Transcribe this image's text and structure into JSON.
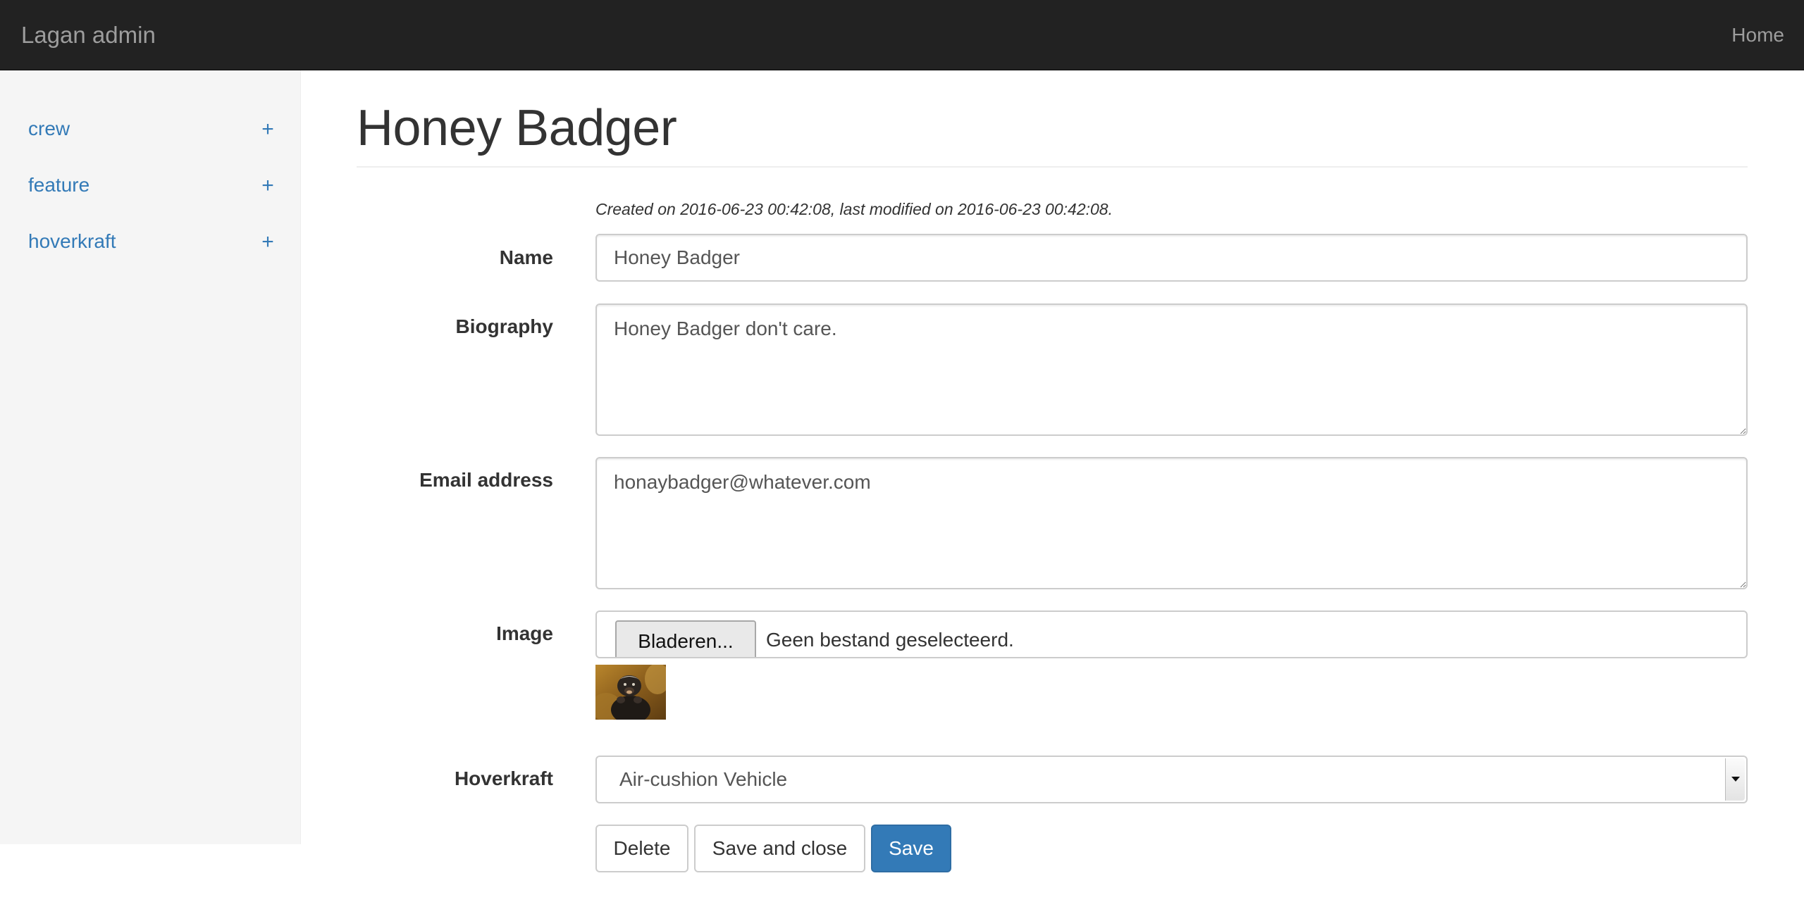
{
  "navbar": {
    "brand": "Lagan admin",
    "home_label": "Home"
  },
  "sidebar": {
    "items": [
      {
        "label": "crew",
        "add": "+"
      },
      {
        "label": "feature",
        "add": "+"
      },
      {
        "label": "hoverkraft",
        "add": "+"
      }
    ]
  },
  "page": {
    "title": "Honey Badger",
    "meta": "Created on 2016-06-23 00:42:08, last modified on 2016-06-23 00:42:08."
  },
  "form": {
    "name": {
      "label": "Name",
      "value": "Honey Badger"
    },
    "biography": {
      "label": "Biography",
      "value": "Honey Badger don't care."
    },
    "email": {
      "label": "Email address",
      "value": "honaybadger@whatever.com"
    },
    "image": {
      "label": "Image",
      "browse_label": "Bladeren...",
      "status": "Geen bestand geselecteerd.",
      "thumbnail_icon": "honey-badger-photo"
    },
    "hoverkraft": {
      "label": "Hoverkraft",
      "selected": "Air-cushion Vehicle"
    }
  },
  "actions": {
    "delete_label": "Delete",
    "save_close_label": "Save and close",
    "save_label": "Save"
  },
  "colors": {
    "navbar_bg": "#222222",
    "link": "#337ab7",
    "primary": "#337ab7",
    "sidebar_bg": "#f5f5f5"
  }
}
